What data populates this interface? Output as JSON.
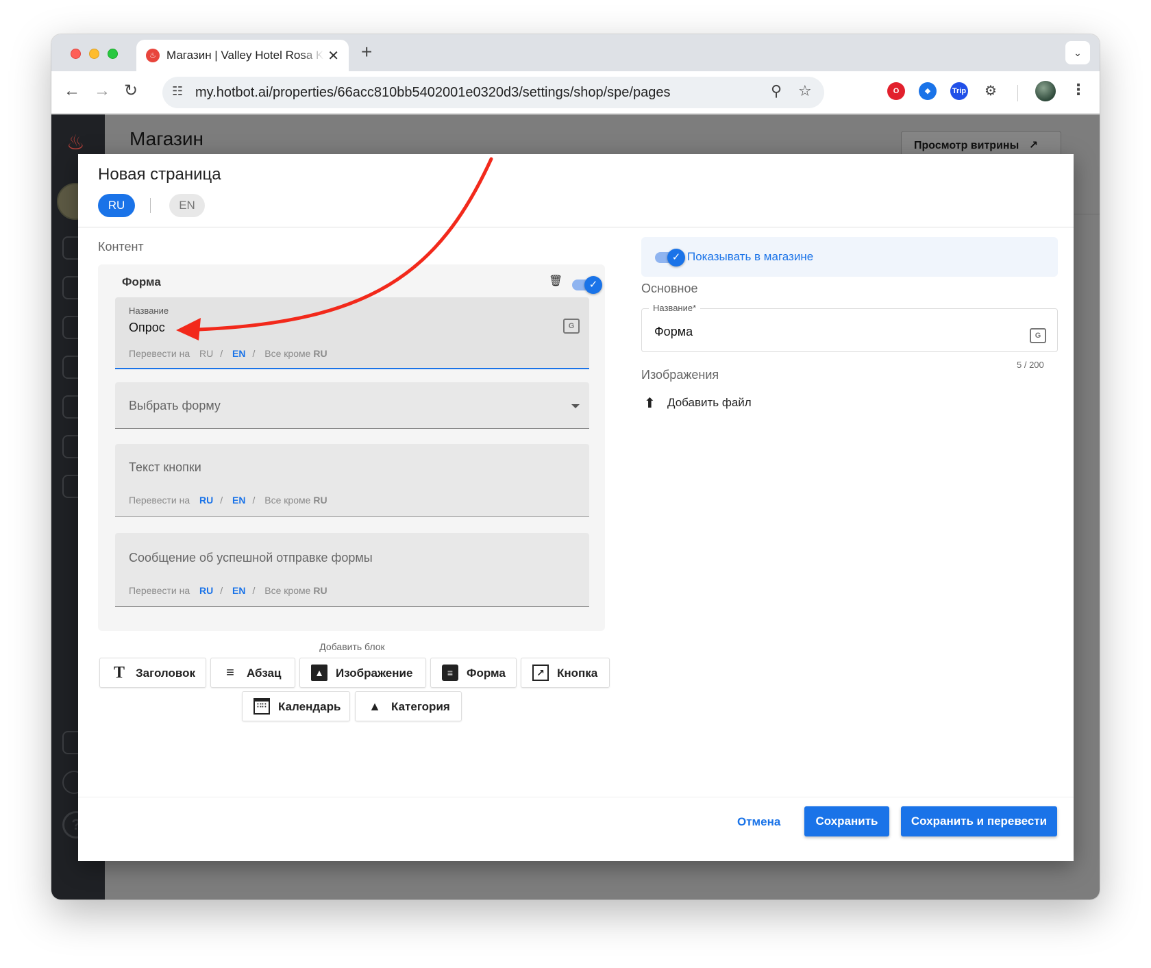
{
  "browser": {
    "tab_title": "Магазин | Valley Hotel Rosa K",
    "tab_favicon": "flame-icon",
    "url": "my.hotbot.ai/properties/66acc810bb5402001e0320d3/settings/shop/spe/pages",
    "extensions": [
      {
        "name": "opera-icon",
        "color": "#e2202c"
      },
      {
        "name": "tag-extension-icon",
        "color": "#1a73e8"
      },
      {
        "name": "trip-extension-icon",
        "color": "#2150e8",
        "label": "Trip"
      },
      {
        "name": "puzzle-icon",
        "color": "#444444"
      }
    ]
  },
  "app": {
    "page_title": "Магазин",
    "preview_button": "Просмотр витрины",
    "preview_icon": "↗"
  },
  "modal": {
    "title": "Новая страница",
    "languages": [
      {
        "code": "RU",
        "active": true
      },
      {
        "code": "EN",
        "active": false
      }
    ],
    "content_label": "Контент",
    "block": {
      "title": "Форма",
      "enabled": true,
      "name_field": {
        "label": "Название",
        "value": "Опрос",
        "translate_prefix": "Перевести на",
        "translate_ru": "RU",
        "translate_en": "EN",
        "translate_all_prefix": "Все кроме",
        "translate_all_lang": "RU"
      },
      "form_select": {
        "placeholder": "Выбрать форму"
      },
      "button_text_field": {
        "placeholder": "Текст кнопки",
        "translate_prefix": "Перевести на",
        "translate_ru": "RU",
        "translate_en": "EN",
        "translate_all_prefix": "Все кроме",
        "translate_all_lang": "RU"
      },
      "success_message_field": {
        "placeholder": "Сообщение об успешной отправке формы",
        "translate_prefix": "Перевести на",
        "translate_ru": "RU",
        "translate_en": "EN",
        "translate_all_prefix": "Все кроме",
        "translate_all_lang": "RU"
      }
    },
    "add_block": {
      "label": "Добавить блок",
      "buttons": [
        {
          "label": "Заголовок",
          "icon": "title-icon"
        },
        {
          "label": "Абзац",
          "icon": "paragraph-icon"
        },
        {
          "label": "Изображение",
          "icon": "image-icon"
        },
        {
          "label": "Форма",
          "icon": "clipboard-icon"
        },
        {
          "label": "Кнопка",
          "icon": "external-link-icon"
        },
        {
          "label": "Календарь",
          "icon": "calendar-icon"
        },
        {
          "label": "Категория",
          "icon": "shapes-icon"
        }
      ]
    },
    "settings": {
      "show_in_shop_label": "Показывать в магазине",
      "show_in_shop": true,
      "main_label": "Основное",
      "name_label": "Название*",
      "name_value": "Форма",
      "counter": "5 / 200",
      "images_label": "Изображения",
      "add_file_label": "Добавить файл"
    },
    "footer": {
      "cancel": "Отмена",
      "save": "Сохранить",
      "save_translate": "Сохранить и перевести"
    }
  },
  "colors": {
    "accent": "#1a73e8",
    "annotation_arrow": "#f2291b"
  }
}
